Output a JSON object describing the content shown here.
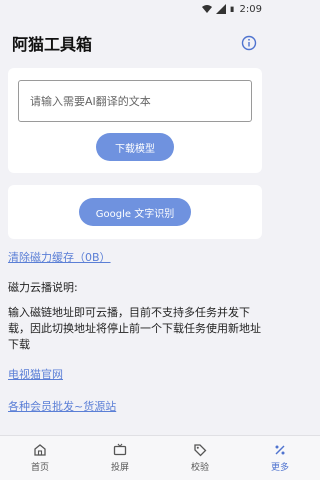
{
  "status": {
    "time": "2:09"
  },
  "app": {
    "title": "阿猫工具箱"
  },
  "translate": {
    "placeholder": "请输入需要AI翻译的文本",
    "download_label": "下载模型"
  },
  "ocr": {
    "label": "Google 文字识别"
  },
  "cache": {
    "clear_label": "清除磁力缓存（0B）"
  },
  "magnet": {
    "title": "磁力云播说明:",
    "description": "输入磁链地址即可云播，目前不支持多任务并发下载，因此切换地址将停止前一个下载任务使用新地址下载"
  },
  "links": {
    "official": "电视猫官网",
    "wholesale": "各种会员批发~货源站"
  },
  "nav": {
    "items": [
      {
        "label": "首页",
        "icon": "home-icon"
      },
      {
        "label": "投屏",
        "icon": "tv-icon"
      },
      {
        "label": "校验",
        "icon": "tag-icon"
      },
      {
        "label": "更多",
        "icon": "percent-icon"
      }
    ],
    "active": "更多"
  },
  "colors": {
    "accent": "#6f92df",
    "link": "#5b7fd6",
    "background": "#f2f2f6"
  }
}
